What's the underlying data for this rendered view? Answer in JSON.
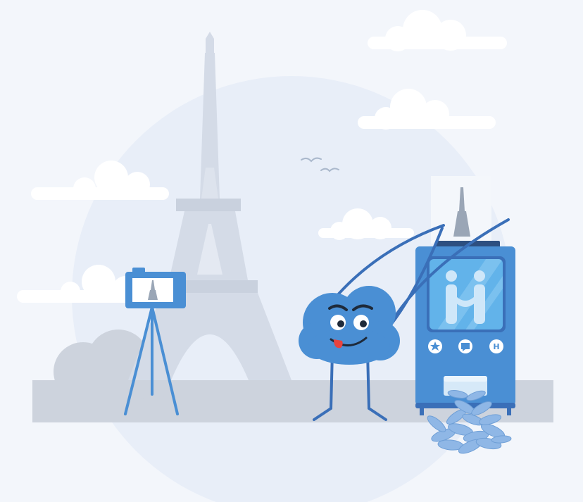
{
  "colors": {
    "background": "#f3f6fb",
    "backdrop_circle": "#e8eef8",
    "ground": "#cdd3dd",
    "tower": "#d4dbe7",
    "tower_shadow": "#c4ccd9",
    "cloud": "#ffffff",
    "accent_blue": "#4a8fd4",
    "dark_blue": "#3a6fb8",
    "screen_blue": "#62b3ea",
    "tongue": "#e8433f"
  },
  "icons": {
    "camera": "camera-icon",
    "tripod": "tripod-icon",
    "eiffel_tower": "eiffel-tower-icon",
    "birds": "bird-icon",
    "cloud_mascot": "cloud-mascot-icon",
    "vending_machine": "vending-machine-icon",
    "star_button": "star-icon",
    "chat_button": "chat-icon",
    "hotel_button": "hotel-icon",
    "machine_logo": "logo-icon",
    "tickets": "ticket-pile-icon"
  },
  "machine": {
    "hotel_button_label": "H"
  }
}
